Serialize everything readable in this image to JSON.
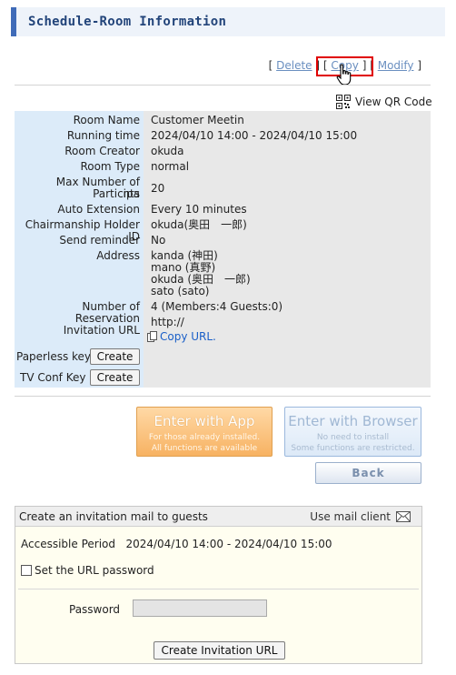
{
  "page": {
    "title": "Schedule-Room Information"
  },
  "actions": {
    "open_bracket": "[",
    "close_bracket": "]",
    "delete_label": "Delete",
    "copy_label": "Copy",
    "modify_label": "Modify"
  },
  "qr": {
    "label": "View QR Code"
  },
  "room": {
    "rows": [
      {
        "label": "Room Name",
        "value": "Customer Meetin"
      },
      {
        "label": "Running time",
        "value": "2024/04/10 14:00 - 2024/04/10 15:00"
      },
      {
        "label": "Room Creator",
        "value": "okuda"
      },
      {
        "label": "Room Type",
        "value": "normal"
      },
      {
        "label_line1": "Max Number of Participa",
        "label_line2": "nts",
        "value": "20"
      },
      {
        "label": "Auto Extension",
        "value": "Every 10 minutes"
      },
      {
        "label": "Chairmanship Holder ID",
        "value": "okuda(奥田　一郎)"
      },
      {
        "label": "Send reminder",
        "value": "No"
      },
      {
        "label": "Address",
        "values": [
          "kanda (神田)",
          "mano (真野)",
          "okuda (奥田　一郎)",
          "sato (sato)"
        ]
      },
      {
        "label": "Number of Reservation",
        "value": "4 (Members:4 Guests:0)"
      },
      {
        "label": "Invitation URL",
        "value": "http://",
        "copy_url": "Copy URL."
      },
      {
        "label": "Paperless key",
        "button": "Create"
      },
      {
        "label": "TV Conf Key",
        "button": "Create"
      }
    ]
  },
  "buttons": {
    "app_main": "Enter with App",
    "app_sub1": "For those already installed.",
    "app_sub2": "All functions are available",
    "browser_main": "Enter with Browser",
    "browser_sub1": "No need to install",
    "browser_sub2": "Some functions are restricted.",
    "back": "Back"
  },
  "mail": {
    "title": "Create an invitation mail to guests",
    "client_label": "Use mail client",
    "accessible_label": "Accessible Period",
    "accessible_value": "2024/04/10 14:00 - 2024/04/10 15:00",
    "set_password_label": "Set the URL password",
    "password_label": "Password",
    "password_value": "",
    "create_button": "Create Invitation URL"
  },
  "colors": {
    "accent": "#3f6bb8",
    "title_text": "#22447a",
    "label_bg": "#dcebf9",
    "value_bg": "#e8e8e8",
    "app_button": "#f7b262",
    "browser_button": "#dce9f7",
    "highlight": "#e00000",
    "link": "#1a5fc8"
  }
}
